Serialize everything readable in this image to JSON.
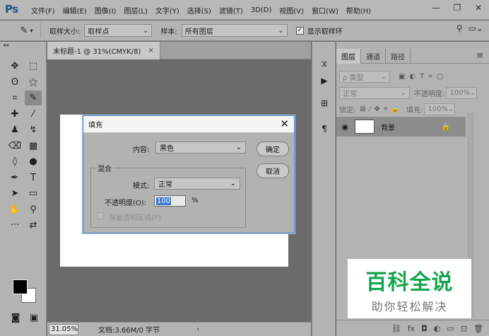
{
  "app": {
    "logo": "Ps",
    "menu": [
      "文件(F)",
      "编辑(E)",
      "图像(I)",
      "图层(L)",
      "文字(Y)",
      "选择(S)",
      "滤镜(T)",
      "3D(D)",
      "视图(V)",
      "窗口(W)",
      "帮助(H)"
    ],
    "window_controls": [
      "—",
      "❐",
      "✕"
    ]
  },
  "options_bar": {
    "tool_icon": "eyedropper-icon",
    "sample_size_label": "取样大小:",
    "sample_size_value": "取样点",
    "sample_label": "样本:",
    "sample_value": "所有图层",
    "show_ring_label": "显示取样环",
    "show_ring_checked": true
  },
  "document": {
    "tab_title": "未标题-1 @ 31%(CMYK/8)",
    "tab_close": "×",
    "zoom": "31.05%",
    "doc_info": "文档:3.66M/0 字节",
    "status_arrow": "›"
  },
  "layers_panel": {
    "tabs": [
      "图层",
      "通道",
      "路径"
    ],
    "active_tab": 0,
    "filter_label": "ρ 类型",
    "blend_mode": "正常",
    "opacity_label": "不透明度:",
    "opacity_value": "100%",
    "lock_label": "锁定:",
    "fill_label": "填充:",
    "fill_value": "100%",
    "layers": [
      {
        "name": "背景",
        "visible": true,
        "locked": true
      }
    ]
  },
  "fill_dialog": {
    "title": "填充",
    "close": "✕",
    "content_label": "内容:",
    "content_value": "黑色",
    "ok_label": "确定",
    "cancel_label": "取消",
    "blend_group_label": "混合",
    "mode_label": "模式:",
    "mode_value": "正常",
    "opacity_label": "不透明度(O):",
    "opacity_value": "100",
    "opacity_unit": "%",
    "preserve_label": "保留透明区域(P)",
    "preserve_enabled": false
  },
  "watermark": {
    "title": "百科全说",
    "subtitle": "助你轻松解决"
  },
  "colors": {
    "foreground": "#000000",
    "background": "#ffffff",
    "dialog_border": "#4d86c9",
    "watermark_green": "#13a64b"
  }
}
